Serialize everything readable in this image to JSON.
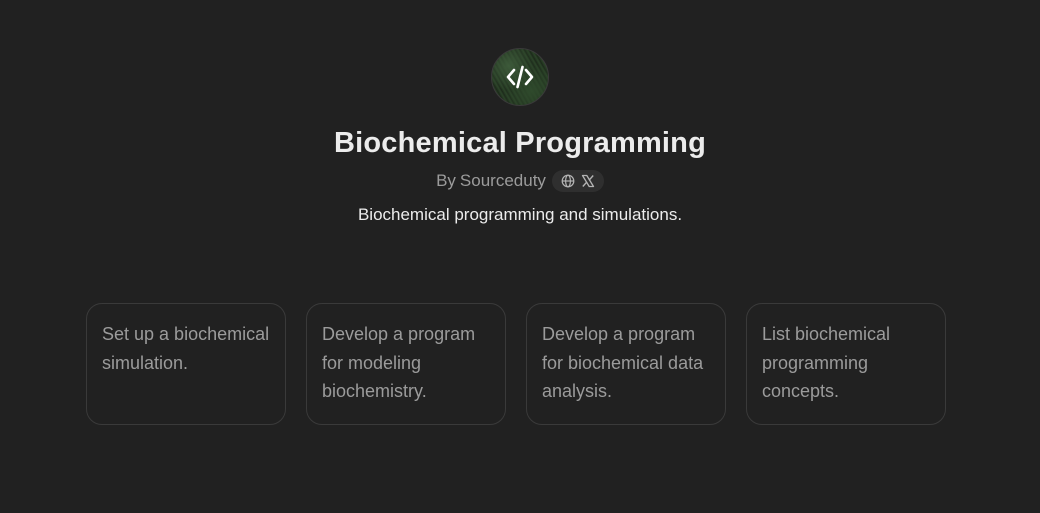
{
  "gpt": {
    "avatar_icon": "code-brackets-icon",
    "title": "Biochemical Programming",
    "byline_prefix": "By",
    "author": "Sourceduty",
    "social_icons": [
      "globe-icon",
      "x-logo-icon"
    ],
    "description": "Biochemical programming and simulations."
  },
  "conversation_starters": [
    {
      "text": "Set up a biochemical simulation."
    },
    {
      "text": "Develop a program for modeling biochemistry."
    },
    {
      "text": "Develop a program for biochemical data analysis."
    },
    {
      "text": "List biochemical programming concepts."
    }
  ],
  "colors": {
    "background": "#212121",
    "card_border": "#3a3a3a",
    "muted_text": "#9b9b9b",
    "primary_text": "#ececec"
  }
}
